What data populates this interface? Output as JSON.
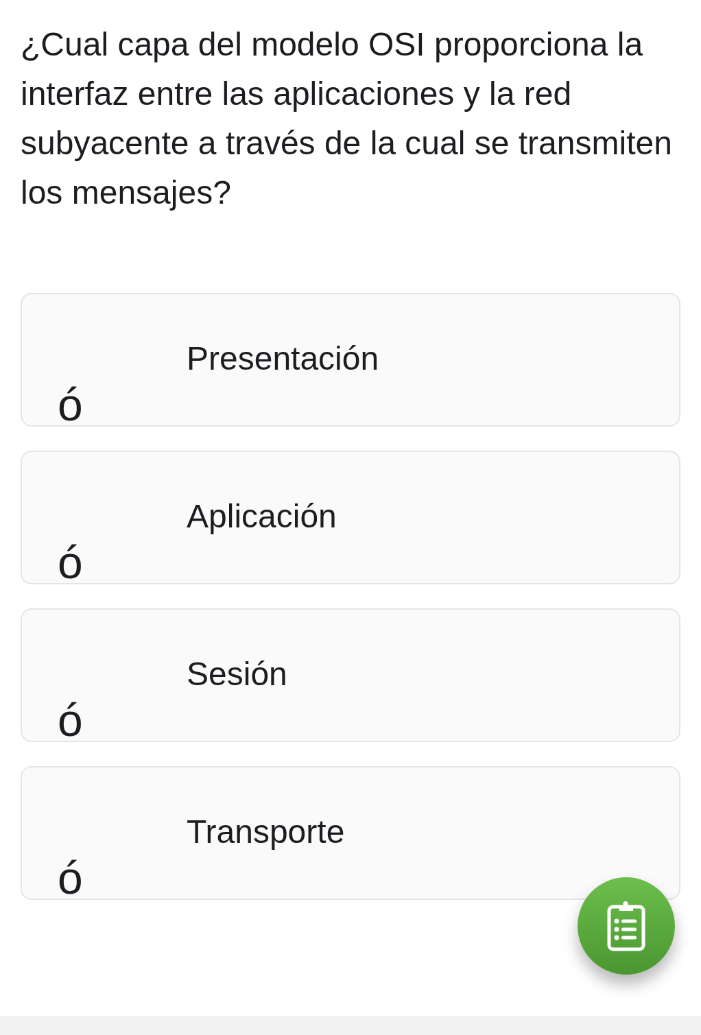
{
  "question": "¿Cual capa del modelo OSI proporciona la interfaz entre las aplicaciones y la red subyacente a través de la cual se transmiten los mensajes?",
  "options": [
    {
      "label": "Presentación",
      "marker": "ó",
      "selected": false
    },
    {
      "label": "Aplicación",
      "marker": "ó",
      "selected": false
    },
    {
      "label": "Sesión",
      "marker": "ó",
      "selected": false
    },
    {
      "label": "Transporte",
      "marker": "ó",
      "selected": false
    }
  ]
}
